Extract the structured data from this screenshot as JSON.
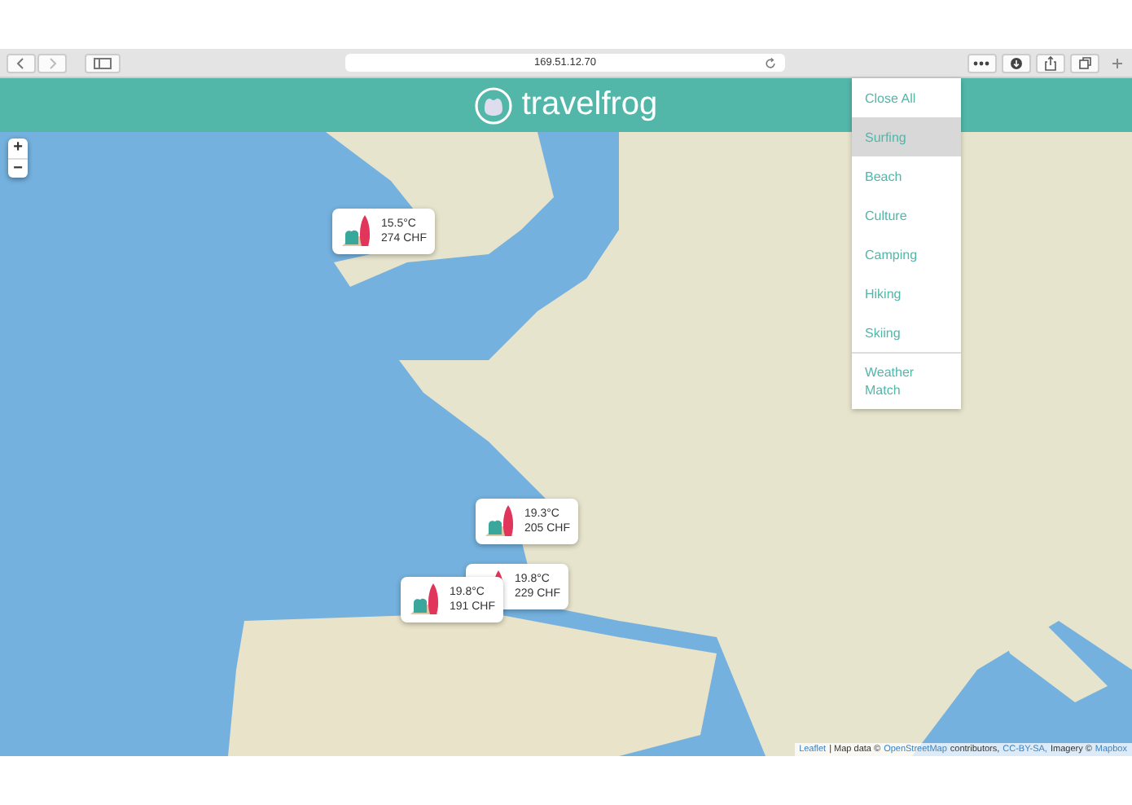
{
  "browser": {
    "url": "169.51.12.70"
  },
  "header": {
    "title": "travelfrog"
  },
  "menu": {
    "items": [
      {
        "label": "Close All",
        "selected": false
      },
      {
        "label": "Surfing",
        "selected": true
      },
      {
        "label": "Beach",
        "selected": false
      },
      {
        "label": "Culture",
        "selected": false
      },
      {
        "label": "Camping",
        "selected": false
      },
      {
        "label": "Hiking",
        "selected": false
      },
      {
        "label": "Skiing",
        "selected": false
      },
      {
        "label": "Weather Match",
        "selected": false
      }
    ]
  },
  "map": {
    "zoom_controls": [
      "+",
      "−"
    ],
    "markers": [
      {
        "temperature": "15.5°C",
        "price": "274 CHF"
      },
      {
        "temperature": "19.3°C",
        "price": "205 CHF"
      },
      {
        "temperature": "19.8°C",
        "price": "229 CHF"
      },
      {
        "temperature": "19.8°C",
        "price": "191 CHF"
      }
    ],
    "attribution": [
      {
        "kind": "link",
        "text": "Leaflet"
      },
      {
        "kind": "text",
        "text": "| Map data ©"
      },
      {
        "kind": "link",
        "text": "OpenStreetMap"
      },
      {
        "kind": "text",
        "text": "contributors,"
      },
      {
        "kind": "link",
        "text": "CC-BY-SA,"
      },
      {
        "kind": "text",
        "text": "Imagery ©"
      },
      {
        "kind": "link",
        "text": "Mapbox"
      }
    ]
  }
}
